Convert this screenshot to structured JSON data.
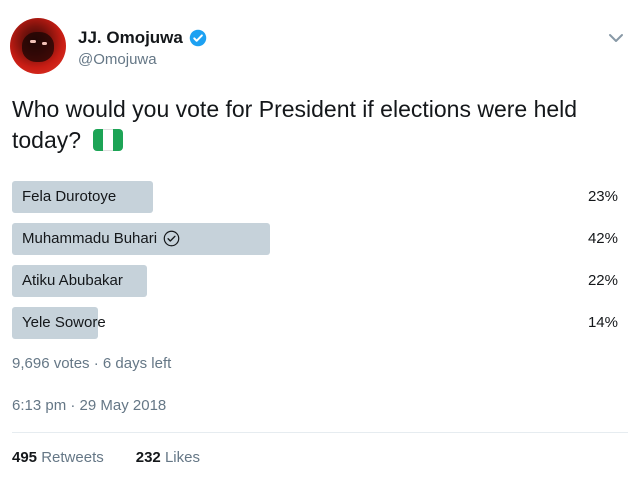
{
  "user": {
    "display_name": "JJ. Omojuwa",
    "handle": "@Omojuwa",
    "verified": true,
    "avatar_icon": "profile-avatar"
  },
  "tweet": {
    "text": "Who would you vote for President if elections were held today?",
    "emoji": "nigeria-flag"
  },
  "poll": {
    "options": [
      {
        "label": "Fela Durotoye",
        "percent_label": "23%",
        "percent": 23,
        "selected": false
      },
      {
        "label": "Muhammadu Buhari",
        "percent_label": "42%",
        "percent": 42,
        "selected": true
      },
      {
        "label": "Atiku Abubakar",
        "percent_label": "22%",
        "percent": 22,
        "selected": false
      },
      {
        "label": "Yele Sowore",
        "percent_label": "14%",
        "percent": 14,
        "selected": false
      }
    ],
    "votes": "9,696 votes",
    "separator": "·",
    "time_left": "6 days left"
  },
  "meta": {
    "time": "6:13 pm",
    "separator": "·",
    "date": "29 May 2018"
  },
  "stats": {
    "retweets_count": "495",
    "retweets_label": "Retweets",
    "likes_count": "232",
    "likes_label": "Likes"
  },
  "colors": {
    "bar": "#c6d2da",
    "verified": "#1da1f2",
    "muted": "#657786",
    "flag_green": "#1da456"
  }
}
